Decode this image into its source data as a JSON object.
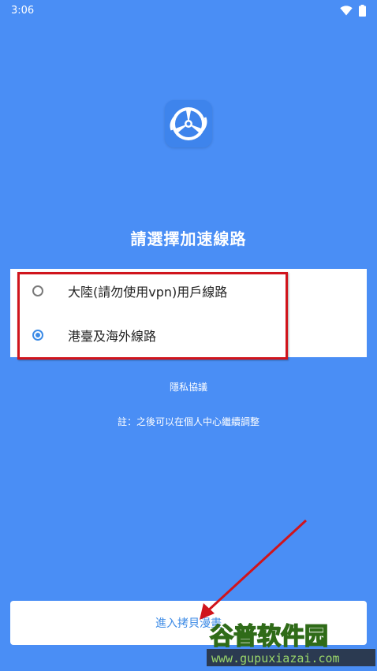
{
  "status_bar": {
    "time": "3:06",
    "icons": [
      "wifi-icon",
      "battery-icon"
    ]
  },
  "app": {
    "logo_icon": "app-logo-icon",
    "title": "請選擇加速線路"
  },
  "options": [
    {
      "label": "大陸(請勿使用vpn)用戶線路",
      "selected": false
    },
    {
      "label": "港臺及海外線路",
      "selected": true
    }
  ],
  "privacy_link": "隱私協議",
  "note": "註：之後可以在個人中心繼續調整",
  "enter_button": "進入拷貝漫畫",
  "annotation": {
    "highlight_color": "#d0141c",
    "arrow_color": "#d0141c"
  },
  "watermark": {
    "brand": "谷普软件园",
    "url": "www.gupuxiazai.com"
  },
  "colors": {
    "background": "#4a8ef5",
    "accent": "#3d8be6"
  }
}
